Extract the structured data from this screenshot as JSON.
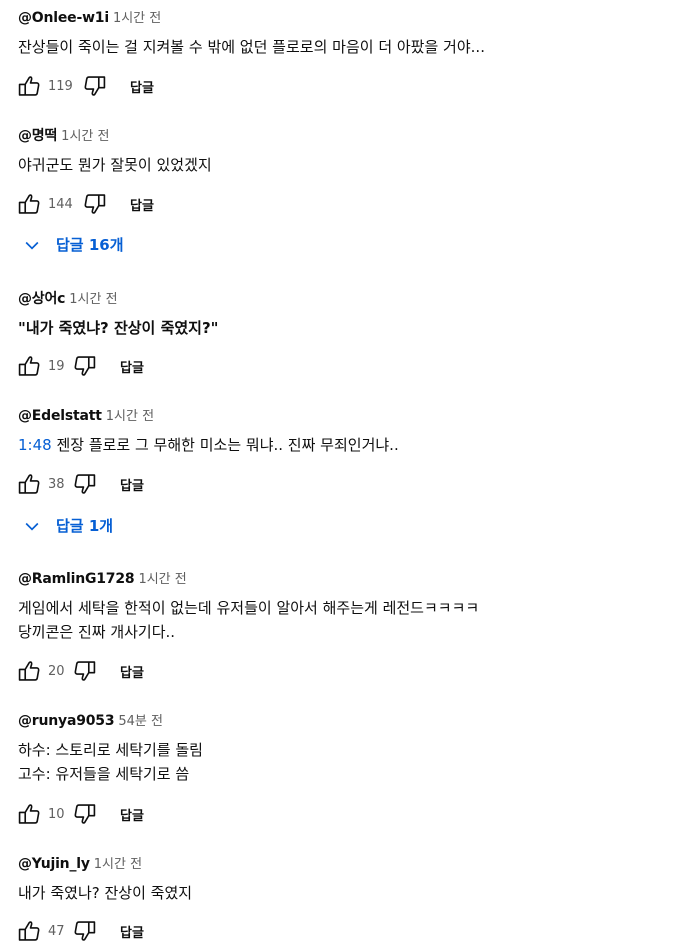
{
  "reply_label": "답글",
  "comments": [
    {
      "author": "@Onlee-w1i",
      "time": "1시간 전",
      "lines": [
        "잔상들이 죽이는 걸 지켜볼 수 밖에 없던 플로로의 마음이   더 아팠을 거야..."
      ],
      "likes": "119"
    },
    {
      "author": "@명떡",
      "time": "1시간 전",
      "lines": [
        "야귀군도 뭔가 잘못이 있었겠지"
      ],
      "likes": "144",
      "replies": "답글 16개"
    },
    {
      "author": "@상어c",
      "time": "1시간 전",
      "lines": [
        "\"내가 죽였냐? 잔상이 죽였지?\""
      ],
      "likes": "19"
    },
    {
      "author": "@Edelstatt",
      "time": "1시간 전",
      "timestamp": "1:48",
      "lines": [
        " 젠장 플로로 그 무해한 미소는 뭐냐.. 진짜 무죄인거냐.."
      ],
      "likes": "38",
      "replies": "답글 1개"
    },
    {
      "author": "@RamlinG1728",
      "time": "1시간 전",
      "lines": [
        "게임에서 세탁을 한적이 없는데 유저들이 알아서 해주는게 레전드ㅋㅋㅋㅋ",
        "당끼콘은 진짜 개사기다.."
      ],
      "likes": "20"
    },
    {
      "author": "@runya9053",
      "time": "54분 전",
      "lines": [
        "하수: 스토리로 세탁기를 돌림",
        "고수: 유저들을 세탁기로 씀"
      ],
      "likes": "10"
    },
    {
      "author": "@Yujin_ly",
      "time": "1시간 전",
      "lines": [
        "내가 죽였나? 잔상이 죽였지"
      ],
      "likes": "47"
    }
  ]
}
